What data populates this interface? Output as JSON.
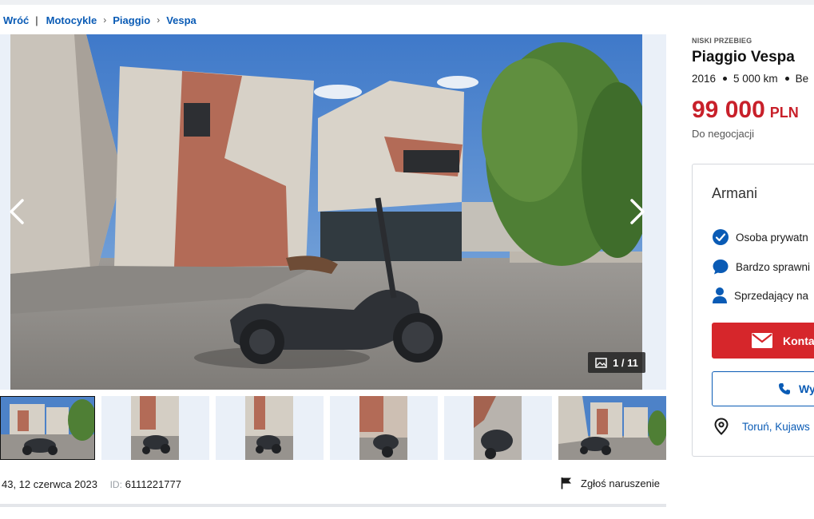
{
  "breadcrumb": {
    "back": "Wróć",
    "items": [
      "Motocykle",
      "Piaggio",
      "Vespa"
    ]
  },
  "gallery": {
    "counter": "1 / 11",
    "current_index": 1,
    "total": 11,
    "prev_icon": "chevron-left-icon",
    "next_icon": "chevron-right-icon",
    "counter_icon": "image-icon"
  },
  "listing": {
    "badge": "NISKI PRZEBIEG",
    "title": "Piaggio Vespa",
    "year": "2016",
    "mileage": "5 000 km",
    "fuel_partial": "Be",
    "price_value": "99 000",
    "price_currency": "PLN",
    "negotiable": "Do negocjacji",
    "date": "43, 12 czerwca 2023",
    "id_label": "ID:",
    "id_value": "6111221777",
    "report": "Zgłoś naruszenie"
  },
  "seller": {
    "name": "Armani",
    "feature_1": "Osoba prywatn",
    "feature_2": "Bardzo sprawni",
    "feature_3": "Sprzedający na",
    "contact_button": "Konta",
    "call_button": "Wy",
    "location": "Toruń, Kujaws"
  },
  "colors": {
    "link": "#0a5bb5",
    "price": "#c8202a",
    "primary_button": "#d6262b"
  }
}
